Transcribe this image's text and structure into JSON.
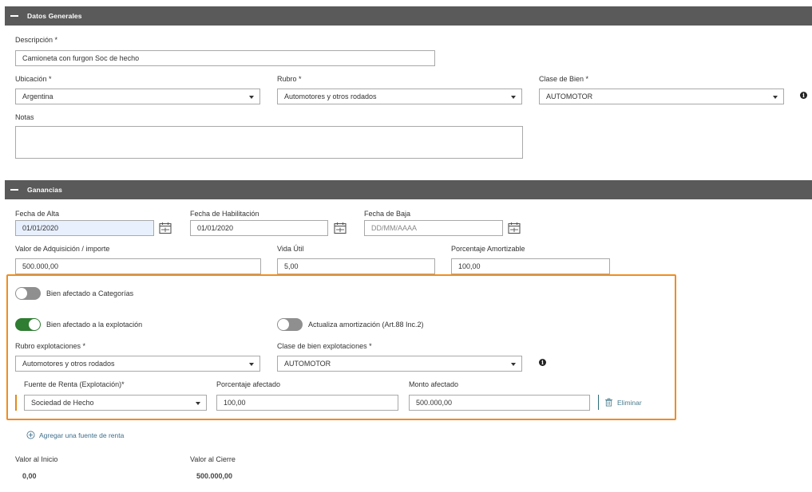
{
  "datos_generales": {
    "header": "Datos Generales",
    "descripcion_label": "Descripción *",
    "descripcion_value": "Camioneta con furgon Soc de hecho",
    "ubicacion_label": "Ubicación *",
    "ubicacion_value": "Argentina",
    "rubro_label": "Rubro *",
    "rubro_value": "Automotores y otros rodados",
    "clase_label": "Clase de Bien *",
    "clase_value": "AUTOMOTOR",
    "notas_label": "Notas",
    "notas_value": ""
  },
  "ganancias": {
    "header": "Ganancias",
    "fecha_alta_label": "Fecha de Alta",
    "fecha_alta_value": "01/01/2020",
    "fecha_hab_label": "Fecha de Habilitación",
    "fecha_hab_value": "01/01/2020",
    "fecha_baja_label": "Fecha de Baja",
    "fecha_baja_placeholder": "DD/MM/AAAA",
    "valor_label": "Valor de Adquisición / importe",
    "valor_value": "500.000,00",
    "vida_label": "Vida Útil",
    "vida_value": "5,00",
    "porc_amort_label": "Porcentaje Amortizable",
    "porc_amort_value": "100,00"
  },
  "afectacion": {
    "categorias_label": "Bien afectado a Categorías",
    "categorias_on": false,
    "explotacion_label": "Bien afectado a la explotación",
    "explotacion_on": true,
    "actualiza_label": "Actualiza amortización (Art.88 Inc.2)",
    "actualiza_on": false,
    "rubro_exp_label": "Rubro explotaciones *",
    "rubro_exp_value": "Automotores y otros rodados",
    "clase_exp_label": "Clase de bien explotaciones *",
    "clase_exp_value": "AUTOMOTOR",
    "fuente_label": "Fuente de Renta (Explotación)*",
    "fuente_value": "Sociedad de Hecho",
    "porc_afectado_label": "Porcentaje afectado",
    "porc_afectado_value": "100,00",
    "monto_label": "Monto afectado",
    "monto_value": "500.000,00",
    "eliminar_label": "Eliminar"
  },
  "agregar_fuente_label": "Agregar una fuente de renta",
  "resumen": {
    "inicio_label": "Valor al Inicio",
    "inicio_value": "0,00",
    "cierre_label": "Valor al Cierre",
    "cierre_value": "500.000,00"
  },
  "colors": {
    "header_bg": "#5a5a5a",
    "highlight_border": "#f08c1e",
    "toggle_on": "#2e7d32",
    "toggle_off": "#8f8f8f",
    "link": "#3d6e8c"
  },
  "icons": {
    "calendar": "calendar-icon",
    "info": "info-icon",
    "trash": "trash-icon",
    "add": "plus-circle-icon",
    "collapse": "minus-icon"
  }
}
